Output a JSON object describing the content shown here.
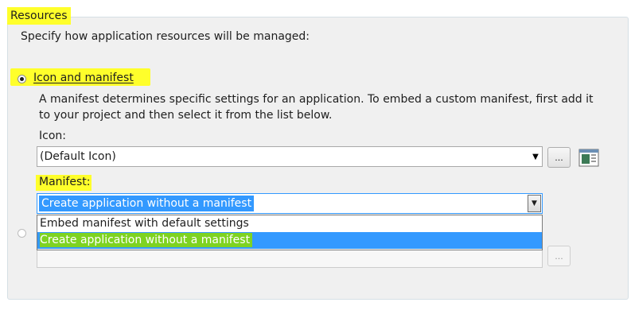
{
  "resources": {
    "title": "Resources",
    "description": "Specify how application resources will be managed:",
    "option_icon_manifest": {
      "label": "Icon and manifest",
      "description_line1": "A manifest determines specific settings for an application. To embed a custom manifest, first add it",
      "description_line2": "to your project and then select it from the list below.",
      "icon_label": "Icon:",
      "icon_value": "(Default Icon)",
      "manifest_label": "Manifest:",
      "manifest_value": "Create application without a manifest",
      "manifest_options": [
        "Embed manifest with default settings",
        "Create application without a manifest"
      ]
    },
    "browse_label": "...",
    "colors": {
      "yellow_highlight": "#ffff2b",
      "green_highlight": "#7ed321",
      "selection_blue": "#3399ff"
    }
  }
}
